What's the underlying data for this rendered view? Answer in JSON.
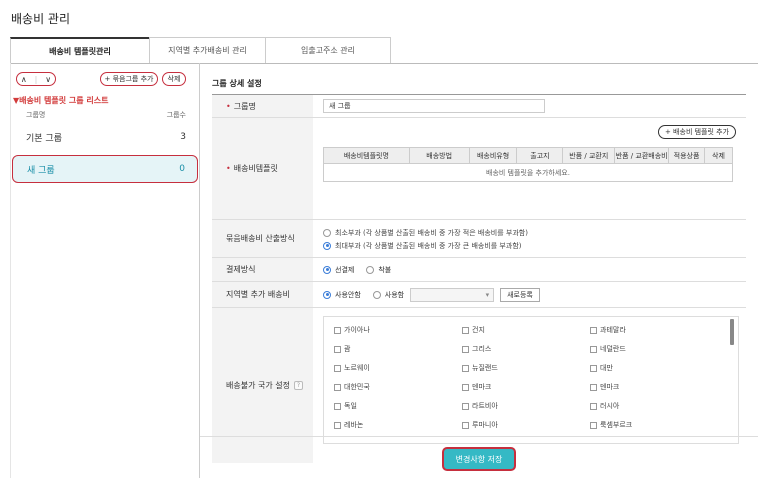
{
  "page": {
    "title": "배송비 관리"
  },
  "tabs": [
    {
      "label": "배송비 템플릿관리"
    },
    {
      "label": "지역별 추가배송비 관리"
    },
    {
      "label": "입출고주소 관리"
    }
  ],
  "left_panel": {
    "up_arrow": "∧",
    "down_arrow": "∨",
    "add_group_label": "+ 묶음그룹 추가",
    "delete_label": "삭제",
    "list_title": "▼배송비 템플릿 그룹 리스트",
    "col_name": "그룹명",
    "col_count": "그룹수",
    "groups": [
      {
        "name": "기본 그룹",
        "count": "3"
      },
      {
        "name": "새 그룹",
        "count": "0"
      }
    ]
  },
  "detail": {
    "section_title": "그룹 상세 설정",
    "group_name_label": "그룹명",
    "group_name_value": "새 그룹",
    "template_label": "배송비템플릿",
    "add_template_label": "+ 배송비 템플릿 추가",
    "template_columns": [
      "배송비템플릿명",
      "배송방법",
      "배송비유형",
      "출고지",
      "반품 / 교환지",
      "반품 / 교환배송비",
      "적용상품",
      "삭제"
    ],
    "template_empty": "배송비 템플릿을 추가하세요.",
    "calc_label": "묶음배송비 산출방식",
    "calc_options": [
      "최소부과 (각 상품별 산출된 배송비 중 가장 적은 배송비를 부과함)",
      "최대부과 (각 상품별 산출된 배송비 중 가장 큰 배송비를 부과함)"
    ],
    "payment_label": "결제방식",
    "payment_options": [
      "선결제",
      "착불"
    ],
    "regional_label": "지역별 추가 배송비",
    "regional_options": [
      "사용안함",
      "사용함"
    ],
    "regional_new": "새로등록",
    "country_label": "배송불가 국가 설정",
    "help_icon": "?",
    "countries": [
      [
        "가이아나",
        "건지",
        "과테말라"
      ],
      [
        "괌",
        "그리스",
        "네덜란드"
      ],
      [
        "노르웨이",
        "뉴질랜드",
        "대만"
      ],
      [
        "대한민국",
        "덴마크",
        "덴마크"
      ],
      [
        "독일",
        "라트비아",
        "러시아"
      ],
      [
        "레바논",
        "루마니아",
        "룩셈부르크"
      ]
    ]
  },
  "save_label": "변경사항 저장",
  "colors": {
    "accent": "#35b9c5",
    "highlight": "#c62f3e",
    "selected_bg": "#e5f4f7"
  }
}
